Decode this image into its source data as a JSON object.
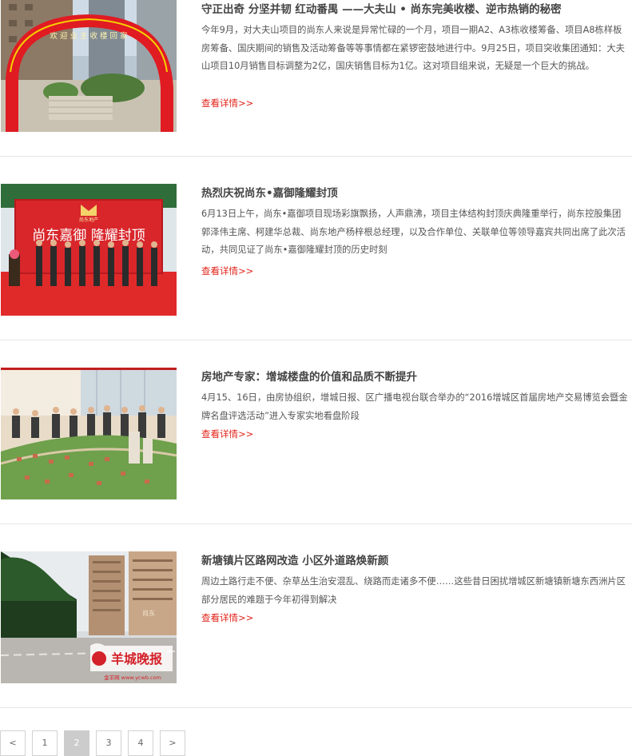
{
  "news": [
    {
      "title": "守正出奇 分坚并韧 红动番禺 ——大夫山 • 尚东完美收楼、逆市热销的秘密",
      "summary": "今年9月，对大夫山项目的尚东人来说是异常忙碌的一个月，项目一期A2、A3栋收楼筹备、项目A8栋样板房筹备、国庆期间的销售及活动筹备等等事情都在紧锣密鼓地进行中。9月25日，项目突收集团通知：大夫山项目10月销售目标调整为2亿，国庆销售目标为1亿。这对项目组来说，无疑是一个巨大的挑战。",
      "more": "查看详情>>",
      "image_text": "欢 迎 业 主 收 楼 回 家"
    },
    {
      "title": "热烈庆祝尚东•嘉御隆耀封顶",
      "summary": "6月13日上午，尚东•嘉御项目现场彩旗飘扬，人声鼎沸，项目主体结构封顶庆典隆重举行，尚东控股集团郭泽伟主席、柯建华总裁、尚东地产杨梓根总经理，以及合作单位、关联单位等领导嘉宾共同出席了此次活动，共同见证了尚东•嘉御隆耀封顶的历史时刻",
      "more": "查看详情>>",
      "image_text": "尚东嘉御 隆耀封顶",
      "image_logo": "尚东地产"
    },
    {
      "title": "房地产专家：增城楼盘的价值和品质不断提升",
      "summary": "4月15、16日，由房协组织，增城日报、区广播电视台联合举办的“2016增城区首届房地产交易博览会暨金牌名盘评选活动”进入专家实地看盘阶段",
      "more": "查看详情>>"
    },
    {
      "title": "新塘镇片区路网改造 小区外道路焕新颜",
      "summary": "周边土路行走不便、杂草丛生治安混乱、绕路而走诸多不便……这些昔日困扰增城区新塘镇新塘东西洲片区部分居民的难题于今年初得到解决",
      "more": "查看详情>>",
      "image_text": "羊城晚报",
      "image_sub": "金羊网 www.ycwb.com",
      "image_sign": "尚东"
    }
  ],
  "pagination": {
    "prev": "<",
    "pages": [
      "1",
      "2",
      "3",
      "4"
    ],
    "current": "2",
    "next": ">"
  },
  "colors": {
    "link": "#e2231a",
    "active_page": "#cccccc"
  }
}
